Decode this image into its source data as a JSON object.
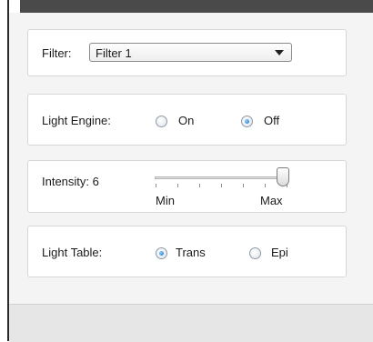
{
  "filter": {
    "label": "Filter:",
    "selected": "Filter 1"
  },
  "light_engine": {
    "label": "Light Engine:",
    "options": [
      {
        "label": "On",
        "checked": false
      },
      {
        "label": "Off",
        "checked": true
      }
    ]
  },
  "intensity": {
    "label": "Intensity: 6",
    "min_label": "Min",
    "max_label": "Max",
    "value": 6
  },
  "light_table": {
    "label": "Light Table:",
    "options": [
      {
        "label": "Trans",
        "checked": true
      },
      {
        "label": "Epi",
        "checked": false
      }
    ]
  }
}
